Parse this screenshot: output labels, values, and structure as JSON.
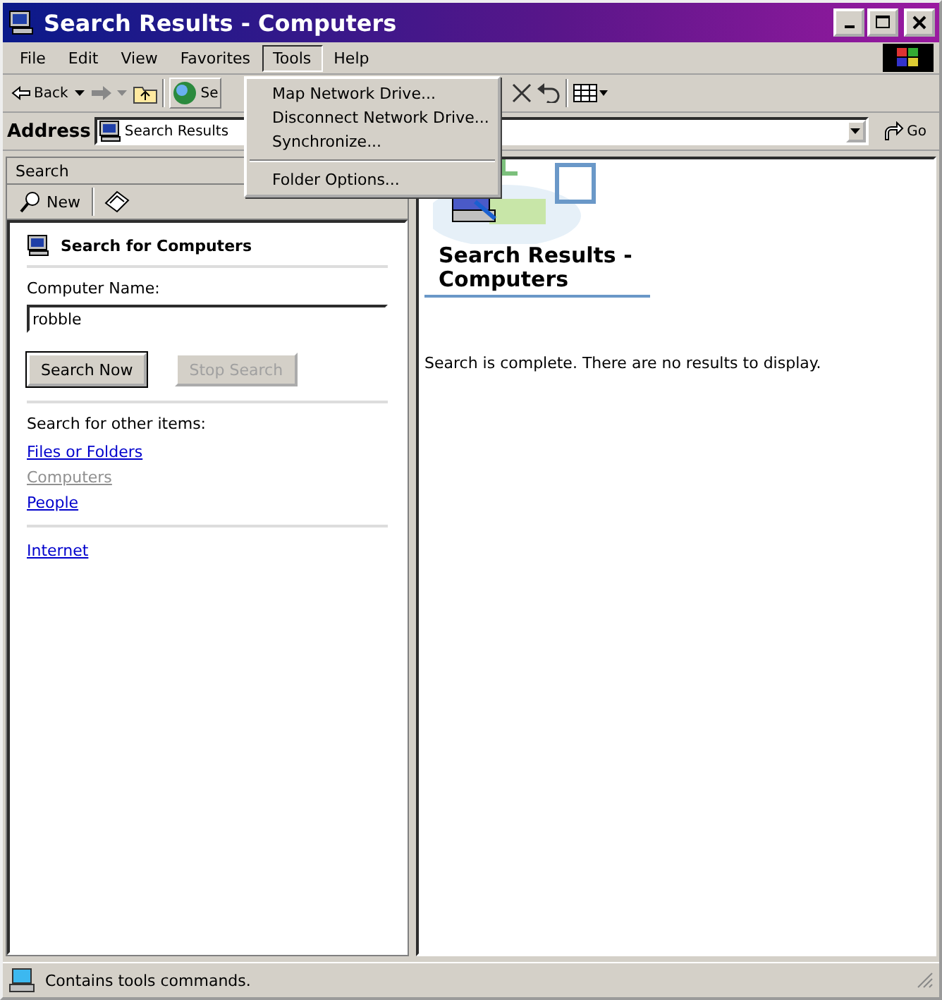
{
  "window": {
    "title": "Search Results - Computers"
  },
  "menu_bar": [
    {
      "label": "File",
      "selected": false
    },
    {
      "label": "Edit",
      "selected": false
    },
    {
      "label": "View",
      "selected": false
    },
    {
      "label": "Favorites",
      "selected": false
    },
    {
      "label": "Tools",
      "selected": true
    },
    {
      "label": "Help",
      "selected": false
    }
  ],
  "open_menu": {
    "groups": [
      [
        {
          "label": "Map Network Drive..."
        },
        {
          "label": "Disconnect Network Drive..."
        },
        {
          "label": "Synchronize..."
        }
      ],
      [
        {
          "label": "Folder Options..."
        }
      ]
    ]
  },
  "toolbar": {
    "back_label": "Back",
    "search_label": "Se"
  },
  "address": {
    "label": "Address",
    "value": "Search Results",
    "go_label": "Go"
  },
  "search_pane": {
    "title": "Search",
    "new_label": "New",
    "heading": "Search for Computers",
    "field_label": "Computer Name:",
    "field_value": "robble",
    "buttons": [
      {
        "label": "Search Now",
        "disabled": false
      },
      {
        "label": "Stop Search",
        "disabled": true
      }
    ],
    "other_label": "Search for other items:",
    "links": [
      {
        "label": "Files or Folders",
        "disabled": false
      },
      {
        "label": "Computers",
        "disabled": true
      },
      {
        "label": "People",
        "disabled": false
      }
    ],
    "extra_links": [
      {
        "label": "Internet",
        "disabled": false
      }
    ]
  },
  "results": {
    "heading": "Search Results - Computers",
    "message": "Search is complete. There are no results to display."
  },
  "status_bar": {
    "text": "Contains tools commands."
  }
}
